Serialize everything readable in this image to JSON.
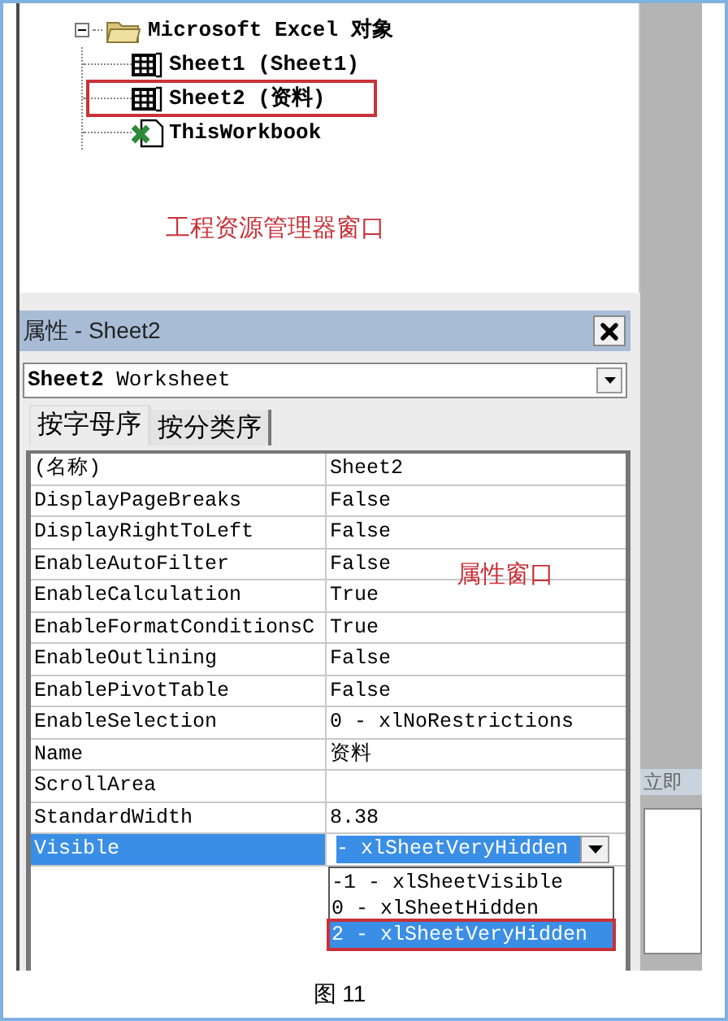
{
  "project_explorer": {
    "tree": [
      {
        "label": "Microsoft Excel 对象",
        "expanded": true,
        "children": [
          {
            "label": "Sheet1 (Sheet1)",
            "kind": "sheet",
            "highlighted": false
          },
          {
            "label": "Sheet2 (资料)",
            "kind": "sheet",
            "highlighted": true
          },
          {
            "label": "ThisWorkbook",
            "kind": "workbook",
            "highlighted": false
          }
        ]
      }
    ],
    "annotation": "工程资源管理器窗口"
  },
  "properties": {
    "title": "属性 - Sheet2",
    "object": {
      "name": "Sheet2",
      "type": "Worksheet"
    },
    "tabs": [
      {
        "label": "按字母序",
        "selected": true
      },
      {
        "label": "按分类序",
        "selected": false
      }
    ],
    "rows": [
      {
        "name": "(名称)",
        "value": "Sheet2",
        "selected": false
      },
      {
        "name": "DisplayPageBreaks",
        "value": "False",
        "selected": false
      },
      {
        "name": "DisplayRightToLeft",
        "value": "False",
        "selected": false
      },
      {
        "name": "EnableAutoFilter",
        "value": "False",
        "selected": false
      },
      {
        "name": "EnableCalculation",
        "value": "True",
        "selected": false
      },
      {
        "name": "EnableFormatConditionsC",
        "value": "True",
        "selected": false
      },
      {
        "name": "EnableOutlining",
        "value": "False",
        "selected": false
      },
      {
        "name": "EnablePivotTable",
        "value": "False",
        "selected": false
      },
      {
        "name": "EnableSelection",
        "value": "0 - xlNoRestrictions",
        "selected": false
      },
      {
        "name": "Name",
        "value": "资料",
        "selected": false
      },
      {
        "name": "ScrollArea",
        "value": "",
        "selected": false
      },
      {
        "name": "StandardWidth",
        "value": "8.38",
        "selected": false
      },
      {
        "name": "Visible",
        "value": "- xlSheetVeryHidden",
        "selected": true
      }
    ],
    "dropdown": {
      "options": [
        {
          "label": "-1 - xlSheetVisible",
          "selected": false,
          "highlighted": false
        },
        {
          "label": "0 - xlSheetHidden",
          "selected": false,
          "highlighted": false
        },
        {
          "label": "2 - xlSheetVeryHidden",
          "selected": true,
          "highlighted": true
        }
      ]
    },
    "annotation": "属性窗口"
  },
  "immediate": {
    "title": "立即"
  },
  "caption": "图 11"
}
